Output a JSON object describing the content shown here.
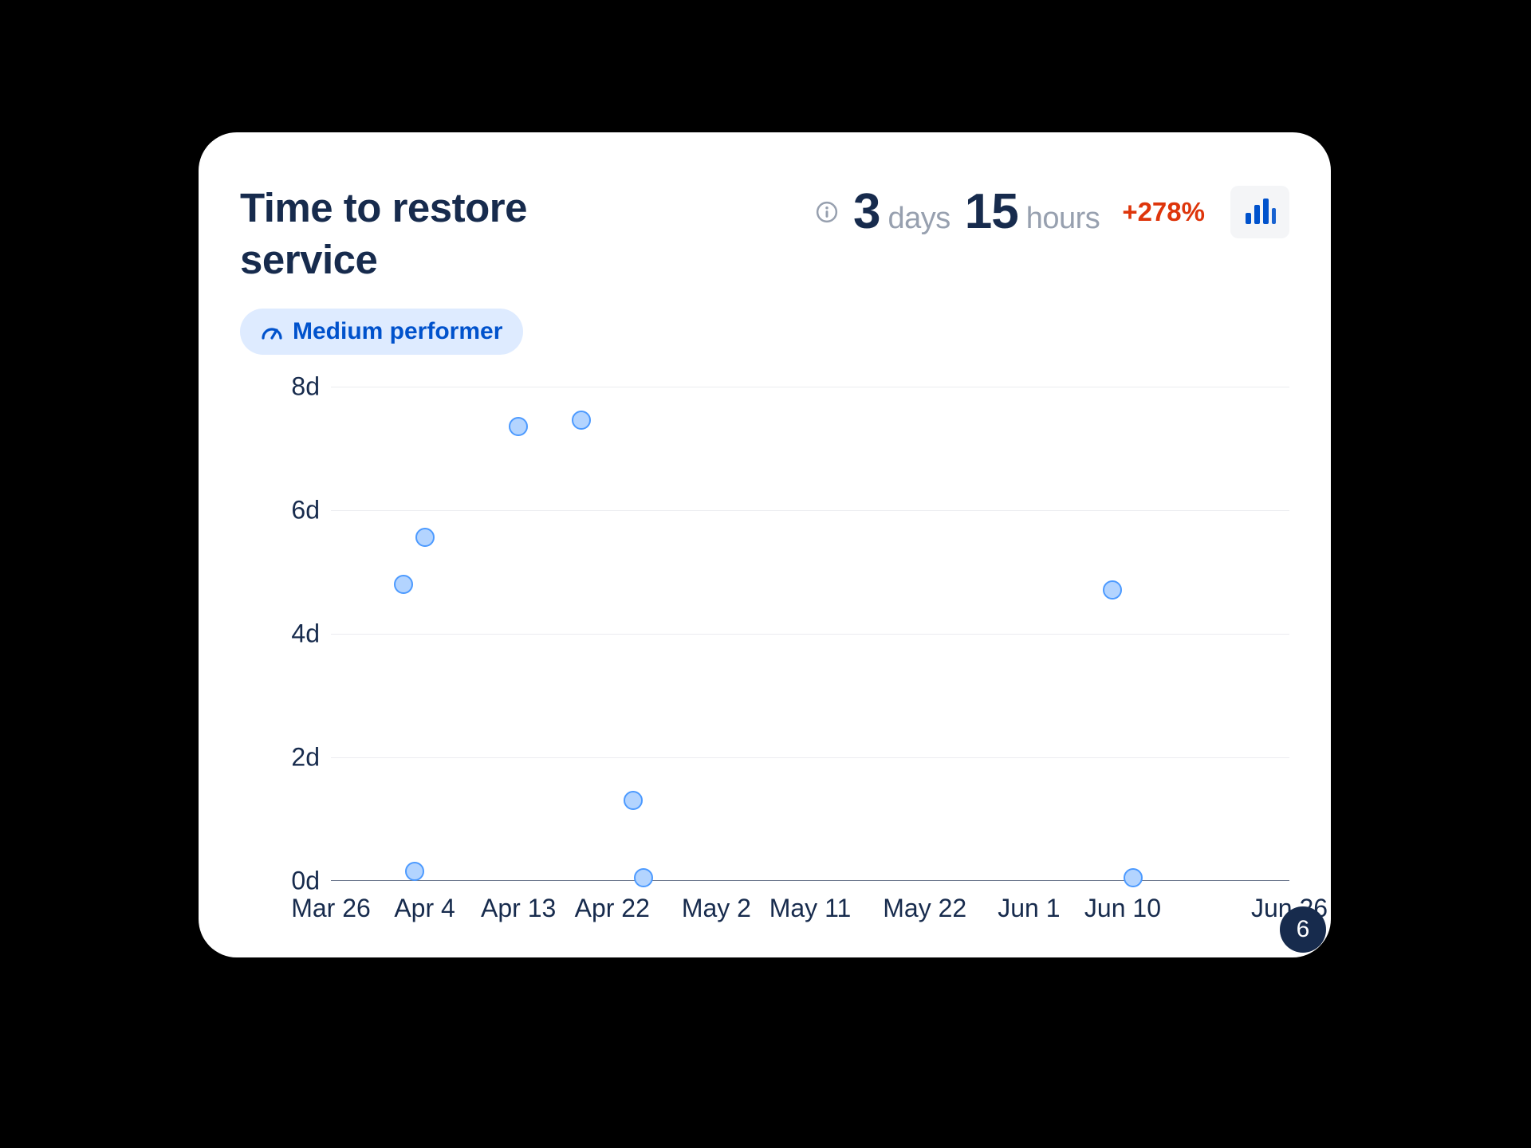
{
  "card": {
    "title": "Time to restore service",
    "metric": {
      "days_value": "3",
      "days_unit": "days",
      "hours_value": "15",
      "hours_unit": "hours",
      "delta": "+278%"
    },
    "performer_pill": "Medium performer",
    "corner_badge": "6"
  },
  "colors": {
    "text_primary": "#172B4D",
    "text_muted": "#97A0AF",
    "danger": "#DE350B",
    "brand": "#0052CC",
    "pill_bg": "#DEEBFF",
    "point_fill": "#B3D4FF",
    "point_stroke": "#4C9AFF",
    "grid": "#EBECF0"
  },
  "chart_data": {
    "type": "scatter",
    "title": "Time to restore service",
    "xlabel": "",
    "ylabel": "",
    "x_type": "date",
    "x_ticks": [
      "Mar 26",
      "Apr 4",
      "Apr 13",
      "Apr 22",
      "May 2",
      "May 11",
      "May 22",
      "Jun 1",
      "Jun 10",
      "Jun 26"
    ],
    "x_range": [
      "2023-03-26",
      "2023-06-26"
    ],
    "y_ticks": [
      "0d",
      "2d",
      "4d",
      "6d",
      "8d"
    ],
    "ylim": [
      0,
      8
    ],
    "y_unit": "days",
    "points": [
      {
        "x": "2023-04-02",
        "y": 4.8
      },
      {
        "x": "2023-04-03",
        "y": 0.15
      },
      {
        "x": "2023-04-04",
        "y": 5.55
      },
      {
        "x": "2023-04-13",
        "y": 7.35
      },
      {
        "x": "2023-04-19",
        "y": 7.45
      },
      {
        "x": "2023-04-24",
        "y": 1.3
      },
      {
        "x": "2023-04-25",
        "y": 0.05
      },
      {
        "x": "2023-06-09",
        "y": 4.7
      },
      {
        "x": "2023-06-11",
        "y": 0.05
      }
    ]
  }
}
